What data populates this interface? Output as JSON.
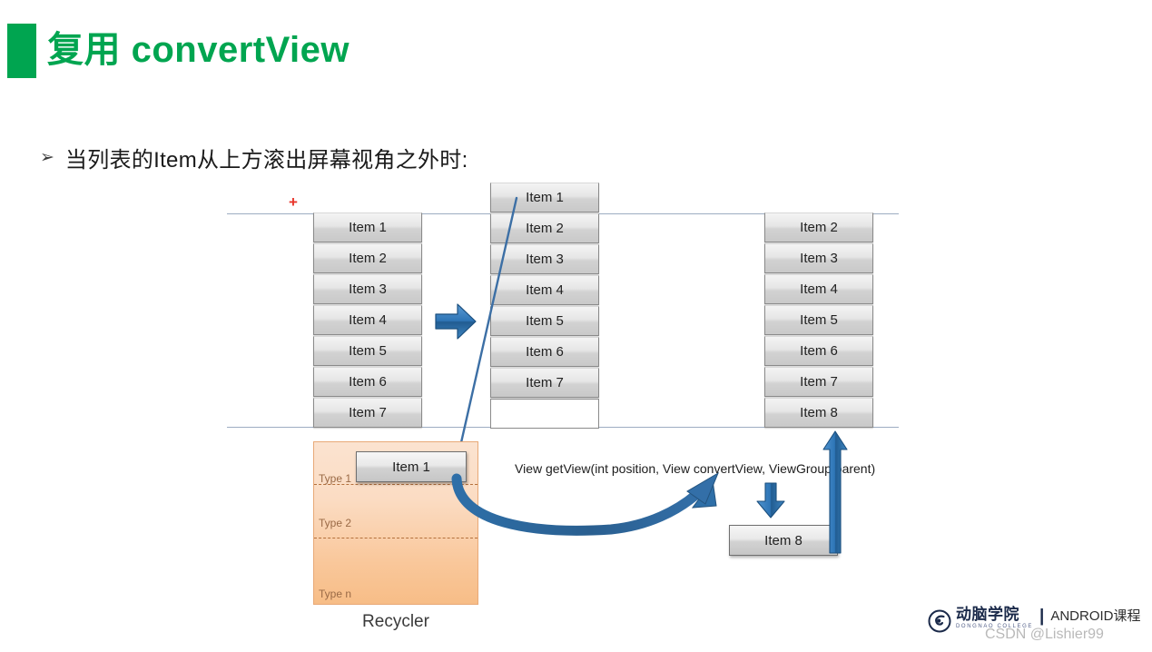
{
  "slide": {
    "title": "复用 convertView",
    "accent_color": "#00A550",
    "bullet_marker": "➢",
    "bullet_text": "当列表的Item从上方滚出屏幕视角之外时:",
    "plus_marker": "+"
  },
  "columns": {
    "left": {
      "name": "original-list",
      "items": [
        "Item 1",
        "Item 2",
        "Item 3",
        "Item 4",
        "Item 5",
        "Item 6",
        "Item 7"
      ]
    },
    "middle": {
      "name": "scrolling-list",
      "items": [
        "Item 1",
        "Item 2",
        "Item 3",
        "Item 4",
        "Item 5",
        "Item 6",
        "Item 7"
      ],
      "blank_slot": ""
    },
    "right": {
      "name": "resulting-list",
      "items": [
        "Item 2",
        "Item 3",
        "Item 4",
        "Item 5",
        "Item 6",
        "Item 7",
        "Item 8"
      ]
    }
  },
  "recycler": {
    "caption": "Recycler",
    "cached_item": "Item 1",
    "types": [
      "Type 1",
      "Type 2",
      "Type n"
    ],
    "fill_color": "#F9C79A",
    "border_color": "#E8A977"
  },
  "flow": {
    "signature": "View getView(int position, View convertView, ViewGroup parent)",
    "new_item": "Item 8",
    "arrow_color": "#2E6FA8"
  },
  "footer": {
    "brand_cn": "动脑学院",
    "brand_en": "DONGNAO COLLEGE",
    "divider": "|",
    "course": "ANDROID课程",
    "watermark": "CSDN @Lishier99"
  }
}
